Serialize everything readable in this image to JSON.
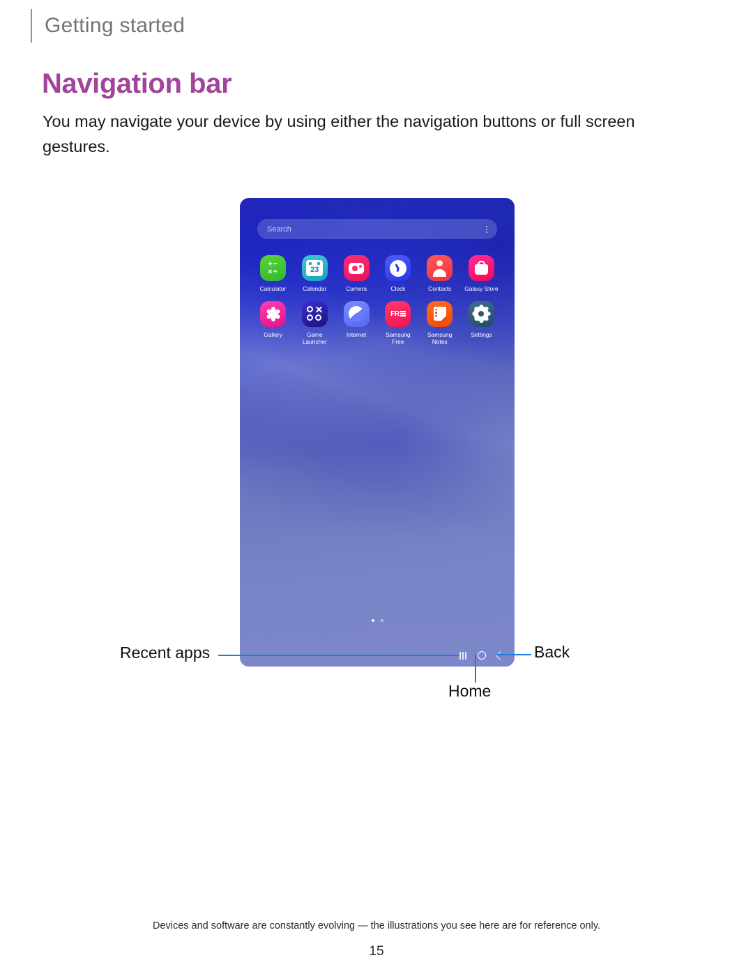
{
  "header": {
    "section": "Getting started"
  },
  "page": {
    "title": "Navigation bar",
    "intro": "You may navigate your device by using either the navigation buttons or full screen gestures."
  },
  "device": {
    "search": {
      "placeholder": "Search",
      "menu_icon": "kebab-menu-icon"
    },
    "apps": [
      {
        "label": "Calculator",
        "icon": "calculator-icon",
        "color": "#45c534",
        "glyph": "+−\n×÷"
      },
      {
        "label": "Calendar",
        "icon": "calendar-icon",
        "color": "#2aafc8",
        "glyph": "23"
      },
      {
        "label": "Camera",
        "icon": "camera-icon",
        "color": "#f51e66",
        "glyph": ""
      },
      {
        "label": "Clock",
        "icon": "clock-icon",
        "color": "#3a45f0",
        "glyph": ""
      },
      {
        "label": "Contacts",
        "icon": "contacts-icon",
        "color": "#f84848",
        "glyph": ""
      },
      {
        "label": "Galaxy Store",
        "icon": "galaxy-store-icon",
        "color": "#fa0f6e",
        "glyph": ""
      },
      {
        "label": "Gallery",
        "icon": "gallery-icon",
        "color": "#f0219c",
        "glyph": ""
      },
      {
        "label": "Game\nLauncher",
        "icon": "game-launcher-icon",
        "color": "#2820a8",
        "glyph": ""
      },
      {
        "label": "Internet",
        "icon": "internet-icon",
        "color": "#6878f8",
        "glyph": ""
      },
      {
        "label": "Samsung\nFree",
        "icon": "samsung-free-icon",
        "color": "#f9265c",
        "glyph": "FREE"
      },
      {
        "label": "Samsung\nNotes",
        "icon": "samsung-notes-icon",
        "color": "#f45a13",
        "glyph": ""
      },
      {
        "label": "Settings",
        "icon": "settings-icon",
        "color": "#2d5878",
        "glyph": ""
      }
    ],
    "page_indicator": {
      "total": 2,
      "active": 1
    },
    "navbar": {
      "recent_icon": "recent-apps-icon",
      "home_icon": "home-circle-icon",
      "back_icon": "back-chevron-icon"
    }
  },
  "callouts": {
    "recent_apps": "Recent apps",
    "home": "Home",
    "back": "Back"
  },
  "footer": {
    "note": "Devices and software are constantly evolving — the illustrations you see here are for reference only.",
    "page_number": "15"
  },
  "colors": {
    "accent_title": "#a0459b",
    "callout_line": "#1f7fe0",
    "section_text": "#6f7479"
  }
}
